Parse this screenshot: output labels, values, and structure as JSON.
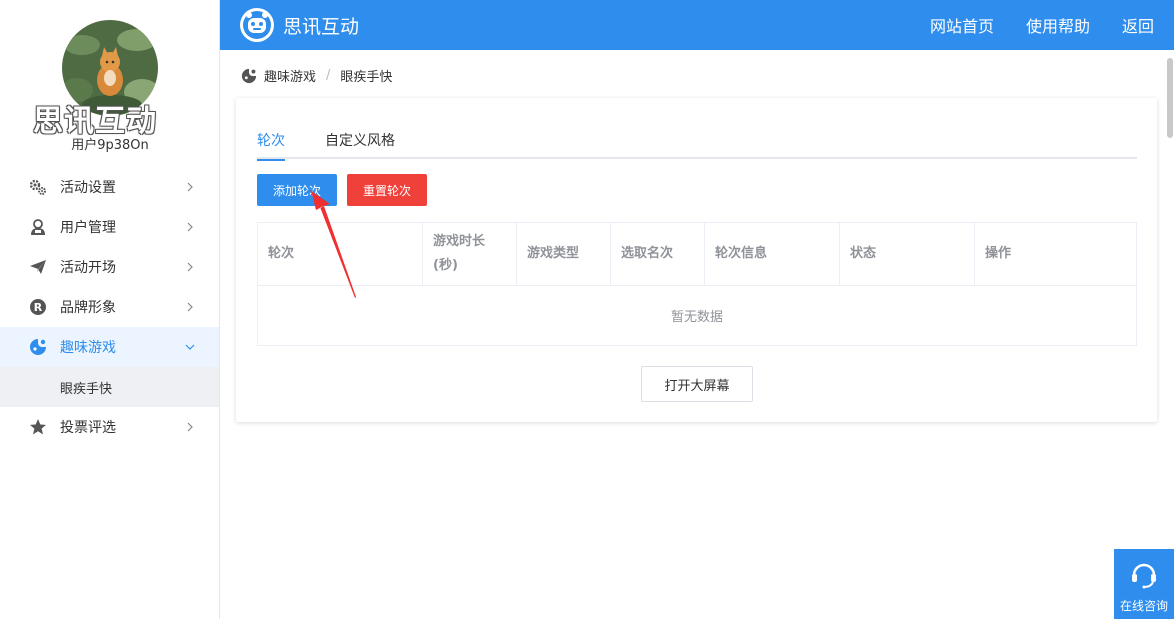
{
  "sidebar": {
    "logo_text": "思讯互动",
    "username": "用户9p38On",
    "items": [
      {
        "label": "活动设置",
        "icon": "gears-icon"
      },
      {
        "label": "用户管理",
        "icon": "user-manage-icon"
      },
      {
        "label": "活动开场",
        "icon": "paper-plane-icon"
      },
      {
        "label": "品牌形象",
        "icon": "registered-icon"
      },
      {
        "label": "趣味游戏",
        "icon": "game-icon",
        "active": true
      },
      {
        "label": "投票评选",
        "icon": "star-icon"
      }
    ],
    "submenu": [
      {
        "label": "眼疾手快"
      }
    ]
  },
  "header": {
    "brand": "思讯互动",
    "nav": [
      "网站首页",
      "使用帮助",
      "返回"
    ]
  },
  "breadcrumb": {
    "items": [
      "趣味游戏",
      "眼疾手快"
    ],
    "separator": "/"
  },
  "tabs": [
    "轮次",
    "自定义风格"
  ],
  "buttons": {
    "add_round": "添加轮次",
    "reset_round": "重置轮次",
    "open_screen": "打开大屏幕"
  },
  "table": {
    "columns": [
      {
        "label": "轮次"
      },
      {
        "label": "游戏时长",
        "label2": "(秒)"
      },
      {
        "label": "游戏类型"
      },
      {
        "label": "选取名次"
      },
      {
        "label": "轮次信息"
      },
      {
        "label": "状态"
      },
      {
        "label": "操作"
      }
    ],
    "empty_text": "暂无数据"
  },
  "consult": {
    "label": "在线咨询"
  },
  "colors": {
    "primary": "#2e8ded",
    "danger": "#f0403a",
    "annotation_arrow": "#f03030"
  }
}
